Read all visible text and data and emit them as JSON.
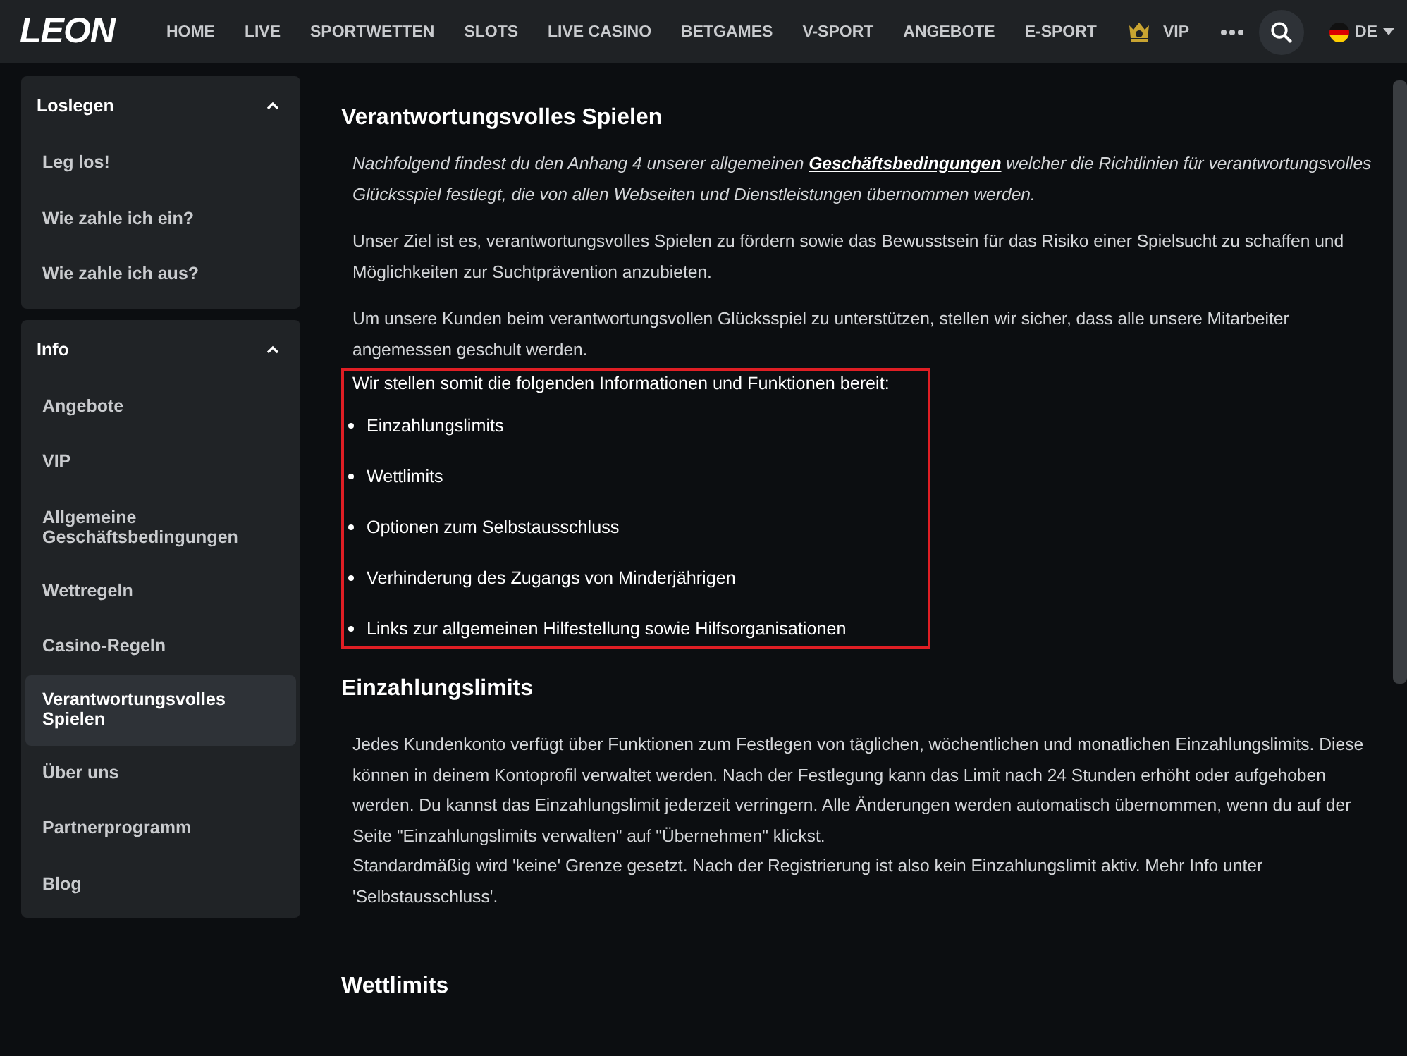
{
  "header": {
    "logo": "LEON",
    "nav": [
      {
        "label": "HOME",
        "kind": "text"
      },
      {
        "label": "LIVE",
        "kind": "text"
      },
      {
        "label": "SPORTWETTEN",
        "kind": "text"
      },
      {
        "label": "SLOTS",
        "kind": "text"
      },
      {
        "label": "LIVE CASINO",
        "kind": "text"
      },
      {
        "label": "BETGAMES",
        "kind": "text"
      },
      {
        "label": "V-SPORT",
        "kind": "text"
      },
      {
        "label": "ANGEBOTE",
        "kind": "text"
      },
      {
        "label": "E-SPORT",
        "kind": "text"
      },
      {
        "label": "VIP",
        "kind": "vip"
      }
    ],
    "language": "DE"
  },
  "sidebar": [
    {
      "title": "Loslegen",
      "expanded": true,
      "items": [
        {
          "label": "Leg los!",
          "selected": false
        },
        {
          "label": "Wie zahle ich ein?",
          "selected": false
        },
        {
          "label": "Wie zahle ich aus?",
          "selected": false
        }
      ]
    },
    {
      "title": "Info",
      "expanded": true,
      "items": [
        {
          "label": "Angebote",
          "selected": false
        },
        {
          "label": "VIP",
          "selected": false
        },
        {
          "label": "Allgemeine Geschäftsbedingungen",
          "selected": false
        },
        {
          "label": "Wettregeln",
          "selected": false
        },
        {
          "label": "Casino-Regeln",
          "selected": false
        },
        {
          "label": "Verantwortungsvolles Spielen",
          "selected": true
        },
        {
          "label": "Über uns",
          "selected": false
        },
        {
          "label": "Partnerprogramm",
          "selected": false
        },
        {
          "label": "Blog",
          "selected": false
        }
      ]
    }
  ],
  "article": {
    "title": "Verantwortungsvolles Spielen",
    "intro": {
      "before": "Nachfolgend findest du den Anhang 4 unserer allgemeinen ",
      "link": "Geschäftsbedingungen",
      "after": " welcher die Richtlinien für verantwortungsvolles Glücksspiel festlegt, die von allen Webseiten und Dienstleistungen übernommen werden."
    },
    "paragraphs": [
      "Unser Ziel ist es, verantwortungsvolles Spielen zu fördern sowie das Bewusstsein für das Risiko einer Spielsucht zu schaffen und Möglichkeiten zur Suchtprävention anzubieten.",
      "Um unsere Kunden beim verantwortungsvollen Glücksspiel zu unterstützen, stellen wir sicher, dass alle unsere Mitarbeiter angemessen geschult werden."
    ],
    "highlighted": {
      "lead": "Wir stellen somit die folgenden Informationen und Funktionen bereit:",
      "bullets": [
        "Einzahlungslimits",
        "Wettlimits",
        "Optionen zum Selbstausschluss",
        "Verhinderung des Zugangs von Minderjährigen",
        "Links zur allgemeinen Hilfestellung sowie Hilfsorganisationen"
      ]
    },
    "sections": [
      {
        "title": "Einzahlungslimits",
        "lines": [
          "Jedes Kundenkonto verfügt über Funktionen zum Festlegen von täglichen, wöchentlichen und monatlichen Einzahlungslimits. Diese können in deinem Kontoprofil verwaltet werden. Nach der Festlegung kann das Limit nach 24 Stunden erhöht oder aufgehoben werden. Du kannst das Einzahlungslimit jederzeit verringern. Alle Änderungen werden automatisch übernommen, wenn du auf der Seite \"Einzahlungslimits verwalten\" auf \"Übernehmen\" klickst.",
          "Standardmäßig wird 'keine' Grenze gesetzt. Nach der Registrierung ist also kein Einzahlungslimit aktiv. Mehr Info unter 'Selbstausschluss'."
        ]
      },
      {
        "title": "Wettlimits"
      }
    ]
  }
}
